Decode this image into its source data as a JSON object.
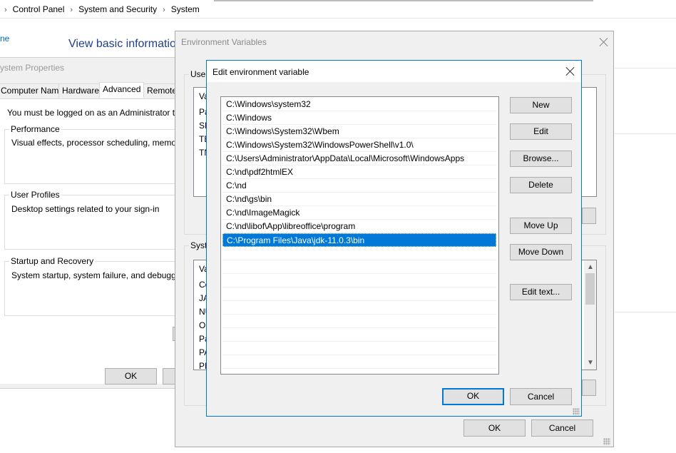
{
  "explorer": {
    "breadcrumb": [
      "Control Panel",
      "System and Security",
      "System"
    ],
    "left_partial": "ne",
    "heading": "View basic informatio"
  },
  "sysprops": {
    "title": "ystem Properties",
    "tabs": [
      "Computer Name",
      "Hardware",
      "Advanced",
      "Remote"
    ],
    "admin_note": "You must be logged on as an Administrator to mak",
    "performance": {
      "label": "Performance",
      "desc": "Visual effects, processor scheduling, memory usa"
    },
    "profiles": {
      "label": "User Profiles",
      "desc": "Desktop settings related to your sign-in"
    },
    "startup": {
      "label": "Startup and Recovery",
      "desc": "System startup, system failure, and debugging inf"
    },
    "ok_label": "OK"
  },
  "envvars": {
    "title": "Environment Variables",
    "user_group_label": "User",
    "user_header": "Va",
    "user_rows": [
      "Pa",
      "SE",
      "TE",
      "TN"
    ],
    "system_group_label": "Syste",
    "system_header": "Va",
    "system_rows": [
      "Co",
      "JA",
      "NU",
      "OS",
      "Pa",
      "PA",
      "PR"
    ],
    "ok_label": "OK",
    "cancel_label": "Cancel"
  },
  "editvar": {
    "title": "Edit environment variable",
    "paths": [
      "C:\\Windows\\system32",
      "C:\\Windows",
      "C:\\Windows\\System32\\Wbem",
      "C:\\Windows\\System32\\WindowsPowerShell\\v1.0\\",
      "C:\\Users\\Administrator\\AppData\\Local\\Microsoft\\WindowsApps",
      "C:\\nd\\pdf2htmlEX",
      "C:\\nd",
      "C:\\nd\\gs\\bin",
      "C:\\nd\\ImageMagick",
      "C:\\nd\\libof\\App\\libreoffice\\program",
      "C:\\Program Files\\Java\\jdk-11.0.3\\bin"
    ],
    "selected_index": 10,
    "buttons": {
      "new": "New",
      "edit": "Edit",
      "browse": "Browse...",
      "delete": "Delete",
      "move_up": "Move Up",
      "move_down": "Move Down",
      "edit_text": "Edit text..."
    },
    "ok_label": "OK",
    "cancel_label": "Cancel"
  },
  "colors": {
    "accent": "#0078d7",
    "dialog_bg": "#f0f0f0",
    "button_bg": "#e1e1e1"
  }
}
